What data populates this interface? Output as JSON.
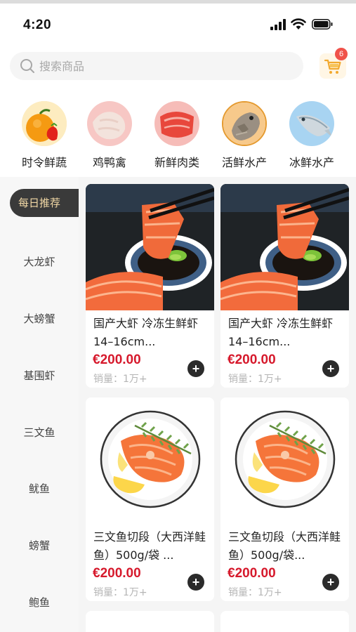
{
  "status_bar": {
    "time": "4:20"
  },
  "search": {
    "placeholder": "搜索商品"
  },
  "cart": {
    "badge_count": "6"
  },
  "categories": [
    {
      "label": "时令鲜蔬",
      "icon": "fruit-icon"
    },
    {
      "label": "鸡鸭禽",
      "icon": "poultry-icon"
    },
    {
      "label": "新鲜肉类",
      "icon": "meat-icon"
    },
    {
      "label": "活鲜水产",
      "icon": "live-seafood-icon"
    },
    {
      "label": "冰鲜水产",
      "icon": "chilled-fish-icon"
    }
  ],
  "sidebar": {
    "items": [
      {
        "label": "每日推荐",
        "active": true
      },
      {
        "label": "大龙虾"
      },
      {
        "label": "大螃蟹"
      },
      {
        "label": "基围虾"
      },
      {
        "label": "三文鱼"
      },
      {
        "label": "鱿鱼"
      },
      {
        "label": "螃蟹"
      },
      {
        "label": "鲍鱼"
      }
    ]
  },
  "products": [
    {
      "title": "国产大虾 冷冻生鲜虾14–16cm...",
      "price": "€200.00",
      "sales": "销量：1万+",
      "image": "salmon-sashimi-image"
    },
    {
      "title": "国产大虾 冷冻生鲜虾14–16cm...",
      "price": "€200.00",
      "sales": "销量：1万+",
      "image": "salmon-sashimi-image"
    },
    {
      "title": "三文鱼切段（大西洋鲑鱼）500g/袋 ...",
      "price": "€200.00",
      "sales": "销量：1万+",
      "image": "salmon-steak-image"
    },
    {
      "title": "三文鱼切段（大西洋鲑鱼）500g/袋...",
      "price": "€200.00",
      "sales": "销量：1万+",
      "image": "salmon-steak-image"
    }
  ],
  "colors": {
    "price": "#d6192c",
    "active_tab_bg": "#3a3a3a",
    "active_tab_text": "#f3d9a6",
    "badge": "#f0524a"
  }
}
